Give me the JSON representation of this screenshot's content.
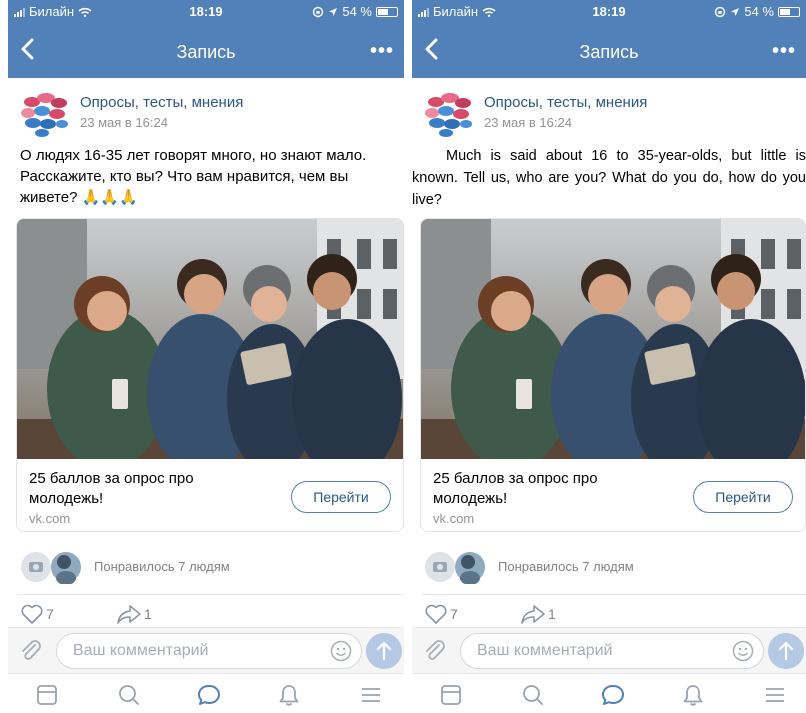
{
  "status_bar": {
    "carrier": "Билайн",
    "time": "18:19",
    "battery": "54 %",
    "battery_level": 0.54
  },
  "nav": {
    "title": "Запись",
    "back_icon": "chevron-left-icon",
    "more_label": "•••"
  },
  "post": {
    "group_name": "Опросы, тесты, мнения",
    "date": "23 мая в 16:24",
    "text_ru": "О людях 16-35 лет говорят много, но знают мало. Расскажите, кто вы? Что вам нравится, чем вы живете?",
    "emoji": "🙏🙏🙏",
    "text_en": "Much is said about 16 to 35-year-olds, but little is known. Tell us, who are you? What do you do, how do you live?"
  },
  "link_card": {
    "title": "25 баллов за опрос про молодежь!",
    "domain": "vk.com",
    "button_label": "Перейти"
  },
  "likes": {
    "liked_text": "Понравилось 7 людям",
    "like_count": "7",
    "share_count": "1"
  },
  "comment": {
    "placeholder": "Ваш комментарий"
  },
  "colors": {
    "header": "#5181b8",
    "link": "#2a5885",
    "muted": "#939393"
  },
  "tabbar": {
    "icons": [
      "news-icon",
      "search-icon",
      "messages-icon",
      "notifications-icon",
      "menu-icon"
    ]
  }
}
